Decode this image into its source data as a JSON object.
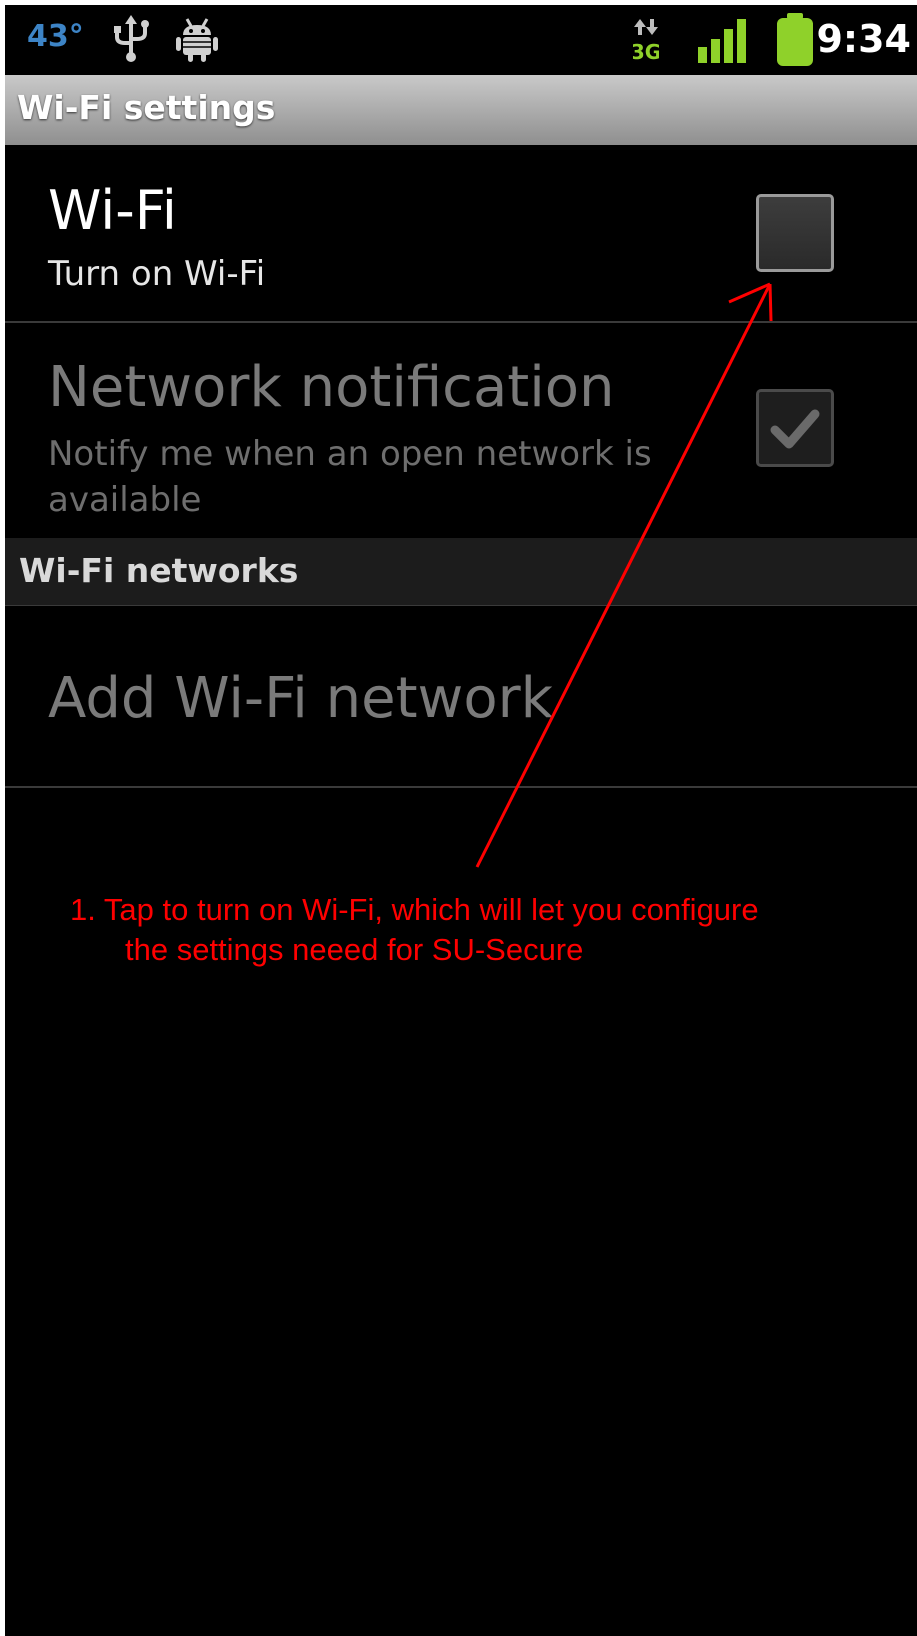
{
  "status_bar": {
    "temperature": "43°",
    "time": "9:34",
    "icons": [
      "usb-icon",
      "android-icon",
      "data-3g-icon",
      "signal-icon",
      "battery-icon"
    ],
    "data_label": "3G",
    "colors": {
      "temperature": "#3d84c6",
      "signal": "#8fd12a",
      "battery": "#8fd12a"
    }
  },
  "title_bar": {
    "title": "Wi-Fi settings"
  },
  "wifi_row": {
    "title": "Wi-Fi",
    "summary": "Turn on Wi-Fi",
    "checked": false
  },
  "notification_row": {
    "title": "Network notification",
    "summary": "Notify me when an open network is available",
    "checked": true,
    "enabled": false
  },
  "networks_section": {
    "header": "Wi-Fi networks"
  },
  "add_network_row": {
    "title": "Add Wi-Fi network",
    "enabled": false
  },
  "annotation": {
    "line1": "1.  Tap to turn on Wi-Fi, which will let you configure",
    "line2": "the settings neeed for SU-Secure",
    "color": "#ff0000"
  }
}
